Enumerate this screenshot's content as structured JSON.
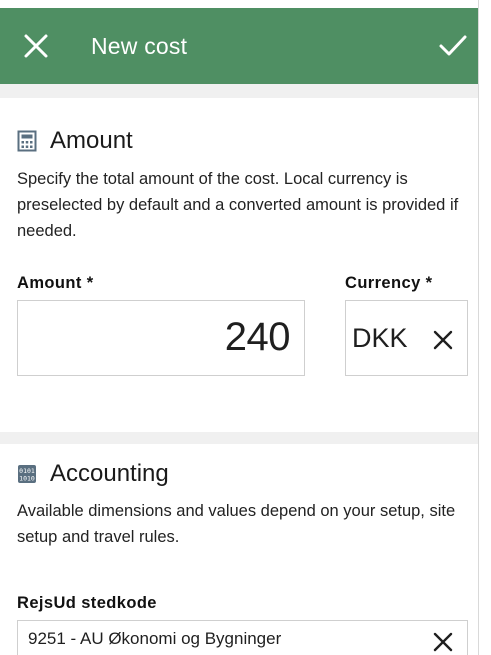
{
  "app_bar": {
    "title": "New cost",
    "close_icon": "close-icon",
    "confirm_icon": "check-icon",
    "background": "#4f8f63"
  },
  "amount_section": {
    "icon": "calculator-icon",
    "title": "Amount",
    "description": "Specify the total amount of the cost. Local currency is preselected by default and a converted amount is provided if needed.",
    "amount_label": "Amount *",
    "amount_value": "240",
    "currency_label": "Currency *",
    "currency_value": "DKK"
  },
  "accounting_section": {
    "icon": "dimensions-icon",
    "title": "Accounting",
    "description": "Available dimensions and values depend on your setup, site setup and travel rules.",
    "stedkode_label": "RejsUd stedkode",
    "stedkode_value": "9251 - AU Økonomi og Bygninger"
  }
}
